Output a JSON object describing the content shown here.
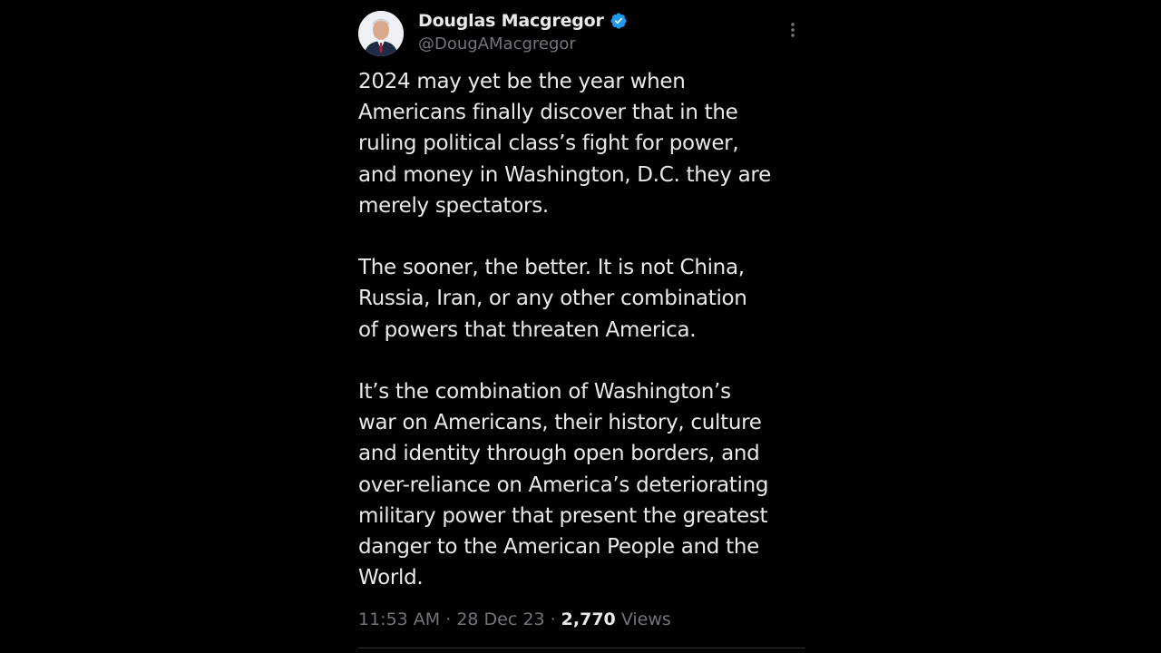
{
  "tweet": {
    "author": {
      "display_name": "Douglas Macgregor",
      "handle": "@DougAMacgregor",
      "verified": true,
      "verified_color": "#1d9bf0"
    },
    "paragraphs": [
      [
        "2024 may yet be the year when",
        "Americans finally discover that in the",
        "ruling political class’s fight for power,",
        "and money in Washington, D.C. they are",
        "merely spectators."
      ],
      [
        "The sooner, the better. It is not China,",
        "Russia, Iran, or any other combination",
        "of powers that threaten America."
      ],
      [
        "It’s the combination of Washington’s",
        "war on Americans, their history, culture",
        "and identity through open borders, and",
        "over-reliance on America’s deteriorating",
        "military power that present the greatest",
        "danger to the American People and the",
        "World."
      ]
    ],
    "meta": {
      "time": "11:53 AM",
      "separator": "·",
      "date": "28 Dec 23",
      "views_count": "2,770",
      "views_label": "Views"
    }
  },
  "icons": {
    "verified": "verified-badge-icon",
    "more": "more-options-icon"
  },
  "colors": {
    "background": "#000000",
    "text": "#e7e9ea",
    "secondary_text": "#71767b",
    "divider": "#2f3336"
  }
}
